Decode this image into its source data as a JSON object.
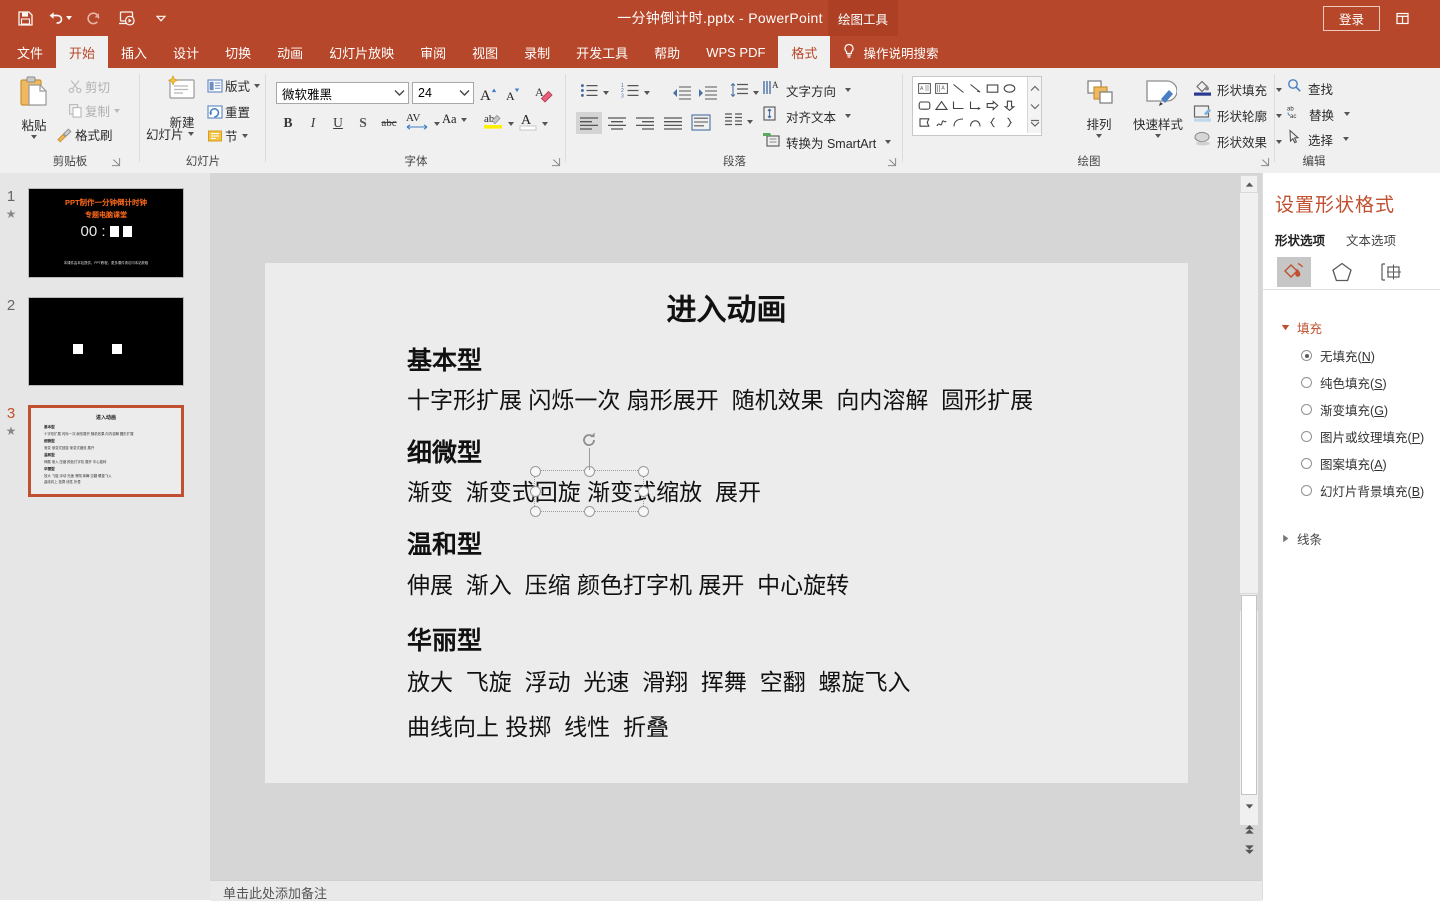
{
  "titlebar": {
    "document_title": "一分钟倒计时.pptx  -  PowerPoint",
    "context_tab_group": "绘图工具",
    "login_label": "登录",
    "quick_access": [
      {
        "name": "save-icon",
        "label": "保存"
      },
      {
        "name": "undo-icon",
        "label": "撤消"
      },
      {
        "name": "redo-icon",
        "label": "恢复"
      },
      {
        "name": "start-slideshow-icon",
        "label": "从头开始"
      },
      {
        "name": "customize-qat-icon",
        "label": "自定义快速访问工具栏"
      }
    ],
    "restore_icon": "restore-window-icon",
    "accent": "#b7472a"
  },
  "tabs": [
    {
      "label": "文件",
      "active": false
    },
    {
      "label": "开始",
      "active": true
    },
    {
      "label": "插入",
      "active": false
    },
    {
      "label": "设计",
      "active": false
    },
    {
      "label": "切换",
      "active": false
    },
    {
      "label": "动画",
      "active": false
    },
    {
      "label": "幻灯片放映",
      "active": false
    },
    {
      "label": "审阅",
      "active": false
    },
    {
      "label": "视图",
      "active": false
    },
    {
      "label": "录制",
      "active": false
    },
    {
      "label": "开发工具",
      "active": false
    },
    {
      "label": "帮助",
      "active": false
    },
    {
      "label": "WPS PDF",
      "active": false
    },
    {
      "label": "格式",
      "active": true
    }
  ],
  "tell_me": "操作说明搜索",
  "ribbon": {
    "groups": [
      {
        "name": "clipboard",
        "label": "剪贴板"
      },
      {
        "name": "slides",
        "label": "幻灯片"
      },
      {
        "name": "font",
        "label": "字体"
      },
      {
        "name": "paragraph",
        "label": "段落"
      },
      {
        "name": "drawing",
        "label": "绘图"
      },
      {
        "name": "editing",
        "label": "编辑"
      }
    ],
    "clipboard": {
      "paste": "粘贴",
      "cut": "剪切",
      "copy": "复制",
      "format_painter": "格式刷"
    },
    "slides": {
      "new_slide": "新建",
      "new_slide_2": "幻灯片",
      "layout": "版式",
      "reset": "重置",
      "section": "节"
    },
    "font": {
      "font_family": "微软雅黑",
      "font_size": "24",
      "grow_font": "A",
      "shrink_font": "A",
      "clear_format": "清除所有格式",
      "bold": "B",
      "italic": "I",
      "underline": "U",
      "shadow": "S",
      "strikethrough": "abc",
      "char_spacing": "AV",
      "change_case": "Aa",
      "highlight": "ab",
      "font_color": "A"
    },
    "paragraph": {
      "text_direction": "文字方向",
      "align_text": "对齐文本",
      "smartart": "转换为 SmartArt"
    },
    "drawing": {
      "arrange": "排列",
      "quick_styles": "快速样式",
      "shape_fill": "形状填充",
      "shape_outline": "形状轮廓",
      "shape_effects": "形状效果"
    },
    "editing": {
      "find": "查找",
      "replace": "替换",
      "select": "选择"
    }
  },
  "thumbnails": [
    {
      "number": "1",
      "has_star": true,
      "selected": false,
      "title": "PPT制作一分钟倒计时钟",
      "subtitle": "专题电脑课堂",
      "timer": "00 :",
      "footer": "本课件由本站提供，PPT教程，更多课件请访问本站获取"
    },
    {
      "number": "2",
      "has_star": false,
      "selected": false,
      "title": "",
      "subtitle": ""
    },
    {
      "number": "3",
      "has_star": true,
      "selected": true,
      "title": "进入动画",
      "subtitle": ""
    }
  ],
  "slide": {
    "title": "进入动画",
    "sections": [
      {
        "heading": "基本型",
        "items": [
          "十字形扩展",
          "闪烁一次",
          "扇形展开",
          "随机效果",
          "向内溶解",
          "圆形扩展"
        ]
      },
      {
        "heading": "细微型",
        "items": [
          "渐变",
          "渐变式回旋",
          "渐变式缩放",
          "展开"
        ]
      },
      {
        "heading": "温和型",
        "items": [
          "伸展",
          "渐入",
          "压缩",
          "颜色打字机",
          "展开",
          "中心旋转"
        ]
      },
      {
        "heading": "华丽型",
        "items": [
          "放大",
          "飞旋",
          "浮动",
          "光速",
          "滑翔",
          "挥舞",
          "空翻",
          "螺旋飞入"
        ]
      },
      {
        "heading": "",
        "items": [
          "曲线向上",
          "投掷",
          "线性",
          "折叠"
        ]
      }
    ]
  },
  "notes_placeholder": "单击此处添加备注",
  "format_pane": {
    "title": "设置形状格式",
    "tabs": [
      {
        "label": "形状选项",
        "active": true
      },
      {
        "label": "文本选项",
        "active": false
      }
    ],
    "icon_tabs": [
      {
        "name": "fill-line-icon",
        "selected": true
      },
      {
        "name": "effects-icon",
        "selected": false
      },
      {
        "name": "size-properties-icon",
        "selected": false
      }
    ],
    "sections": [
      {
        "label": "填充",
        "expanded": true
      },
      {
        "label": "线条",
        "expanded": false
      }
    ],
    "fill_options": [
      {
        "label": "无填充",
        "accel": "N",
        "selected": true
      },
      {
        "label": "纯色填充",
        "accel": "S",
        "selected": false
      },
      {
        "label": "渐变填充",
        "accel": "G",
        "selected": false
      },
      {
        "label": "图片或纹理填充",
        "accel": "P",
        "selected": false
      },
      {
        "label": "图案填充",
        "accel": "A",
        "selected": false
      },
      {
        "label": "幻灯片背景填充",
        "accel": "B",
        "selected": false
      }
    ]
  },
  "scrollbar": {
    "up_icon": "scroll-up-icon",
    "down_icon": "scroll-down-icon",
    "prev_slide_icon": "previous-slide-icon",
    "next_slide_icon": "next-slide-icon"
  }
}
